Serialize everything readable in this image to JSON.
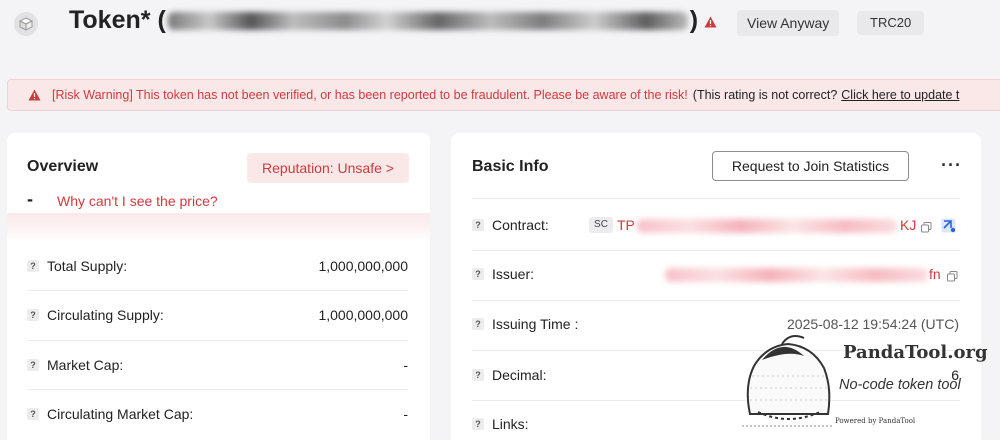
{
  "header": {
    "title_prefix": "Token* (",
    "title_suffix": ")",
    "view_anyway_label": "View Anyway",
    "standard_tag": "TRC20"
  },
  "risk_banner": {
    "warning_text": "[Risk Warning] This token has not been verified, or has been reported to be fraudulent. Please be aware of the risk!",
    "note_text": "(This rating is not correct?",
    "link_text": "Click here to update t"
  },
  "overview": {
    "title": "Overview",
    "reputation_label": "Reputation: Unsafe >",
    "price_value": "-",
    "price_help_link": "Why can't I see the price?",
    "rows": [
      {
        "label": "Total Supply:",
        "value": "1,000,000,000"
      },
      {
        "label": "Circulating Supply:",
        "value": "1,000,000,000"
      },
      {
        "label": "Market Cap:",
        "value": "-"
      },
      {
        "label": "Circulating Market Cap:",
        "value": "-"
      }
    ]
  },
  "basic_info": {
    "title": "Basic Info",
    "request_button_label": "Request to Join Statistics",
    "more_label": "···",
    "contract": {
      "label": "Contract:",
      "badge": "SC",
      "prefix": "TP",
      "suffix": "KJ"
    },
    "issuer": {
      "label": "Issuer:",
      "suffix": "fn"
    },
    "issuing_time": {
      "label": "Issuing Time :",
      "value": "2025-08-12 19:54:24 (UTC)"
    },
    "decimal": {
      "label": "Decimal:",
      "value": "6"
    },
    "links": {
      "label": "Links:"
    }
  },
  "watermark": {
    "brand": "PandaTool.org",
    "tagline": "No-code token tool",
    "powered": "Powered by PandaTool"
  },
  "colors": {
    "danger": "#d0393e",
    "banner_bg": "#fae8e9",
    "page_bg": "#f4f4f7"
  }
}
